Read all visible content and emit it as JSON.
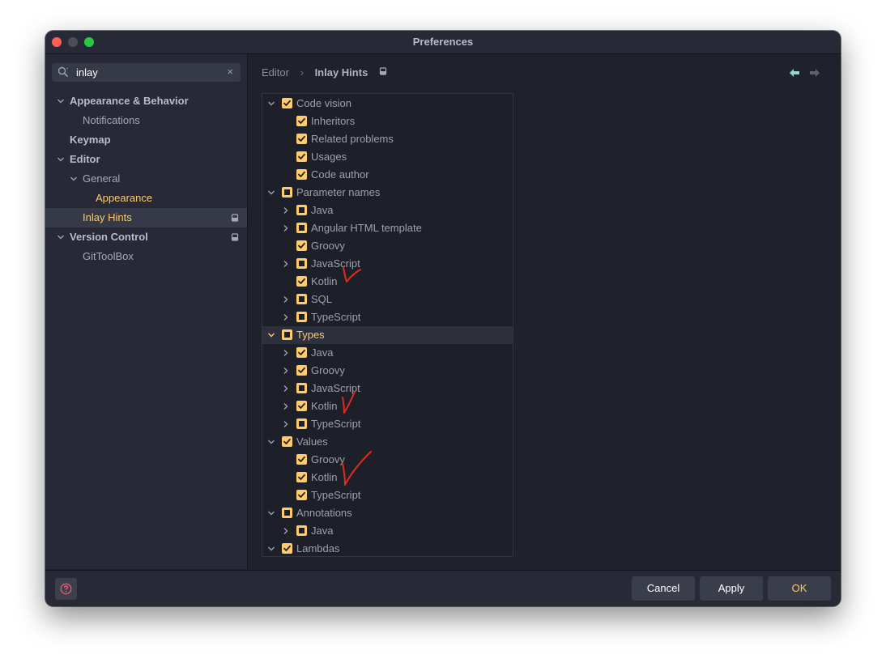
{
  "window": {
    "title": "Preferences"
  },
  "colors": {
    "accent": "#ffcb6b",
    "background": "#1f212c",
    "sidebar": "#272a36",
    "annotation": "#e02b1f",
    "close": "#fe5f57",
    "maximize": "#28c840"
  },
  "search": {
    "value": "inlay",
    "clear_icon": "×",
    "icon": "search-icon"
  },
  "sidebar": {
    "items": [
      {
        "label": "Appearance & Behavior",
        "expanded": true,
        "bold": true
      },
      {
        "label": "Notifications"
      },
      {
        "label": "Keymap",
        "bold": true
      },
      {
        "label": "Editor",
        "expanded": true,
        "bold": true
      },
      {
        "label": "General",
        "expanded": true
      },
      {
        "label": "Appearance",
        "highlight": true
      },
      {
        "label": "Inlay Hints",
        "selected": true,
        "highlight": true,
        "badge": "settings-scope-icon"
      },
      {
        "label": "Version Control",
        "expanded": true,
        "bold": true,
        "badge": "settings-scope-icon"
      },
      {
        "label": "GitToolBox"
      }
    ]
  },
  "breadcrumb": {
    "parent": "Editor",
    "separator": "›",
    "current": "Inlay Hints",
    "badge_icon": "settings-scope-icon"
  },
  "navigation": {
    "back_icon": "arrow-left-icon",
    "forward_icon": "arrow-right-icon"
  },
  "hints": {
    "rows": [
      {
        "label": "Code vision",
        "level": 0,
        "expander": "expanded",
        "state": "checked"
      },
      {
        "label": "Inheritors",
        "level": 1,
        "expander": "none",
        "state": "checked"
      },
      {
        "label": "Related problems",
        "level": 1,
        "expander": "none",
        "state": "checked"
      },
      {
        "label": "Usages",
        "level": 1,
        "expander": "none",
        "state": "checked"
      },
      {
        "label": "Code author",
        "level": 1,
        "expander": "none",
        "state": "checked"
      },
      {
        "label": "Parameter names",
        "level": 0,
        "expander": "expanded",
        "state": "partial"
      },
      {
        "label": "Java",
        "level": 1,
        "expander": "collapsed",
        "state": "partial"
      },
      {
        "label": "Angular HTML template",
        "level": 1,
        "expander": "collapsed",
        "state": "partial"
      },
      {
        "label": "Groovy",
        "level": 1,
        "expander": "none",
        "state": "checked"
      },
      {
        "label": "JavaScript",
        "level": 1,
        "expander": "collapsed",
        "state": "partial"
      },
      {
        "label": "Kotlin",
        "level": 1,
        "expander": "none",
        "state": "checked"
      },
      {
        "label": "SQL",
        "level": 1,
        "expander": "collapsed",
        "state": "partial"
      },
      {
        "label": "TypeScript",
        "level": 1,
        "expander": "collapsed",
        "state": "partial"
      },
      {
        "label": "Types",
        "level": 0,
        "expander": "expanded",
        "state": "partial",
        "selected": true
      },
      {
        "label": "Java",
        "level": 1,
        "expander": "collapsed",
        "state": "checked"
      },
      {
        "label": "Groovy",
        "level": 1,
        "expander": "collapsed",
        "state": "checked"
      },
      {
        "label": "JavaScript",
        "level": 1,
        "expander": "collapsed",
        "state": "partial"
      },
      {
        "label": "Kotlin",
        "level": 1,
        "expander": "collapsed",
        "state": "checked"
      },
      {
        "label": "TypeScript",
        "level": 1,
        "expander": "collapsed",
        "state": "partial"
      },
      {
        "label": "Values",
        "level": 0,
        "expander": "expanded",
        "state": "checked"
      },
      {
        "label": "Groovy",
        "level": 1,
        "expander": "none",
        "state": "checked"
      },
      {
        "label": "Kotlin",
        "level": 1,
        "expander": "none",
        "state": "checked"
      },
      {
        "label": "TypeScript",
        "level": 1,
        "expander": "none",
        "state": "checked"
      },
      {
        "label": "Annotations",
        "level": 0,
        "expander": "expanded",
        "state": "partial"
      },
      {
        "label": "Java",
        "level": 1,
        "expander": "collapsed",
        "state": "partial"
      },
      {
        "label": "Lambdas",
        "level": 0,
        "expander": "expanded",
        "state": "checked"
      }
    ]
  },
  "annotations": [
    {
      "mark": "checkmark",
      "next_to": "Parameter names › Kotlin"
    },
    {
      "mark": "checkmark",
      "next_to": "Types › Kotlin"
    },
    {
      "mark": "checkmark",
      "next_to": "Values › Kotlin"
    }
  ],
  "footer": {
    "help_icon": "help-icon",
    "cancel": "Cancel",
    "apply": "Apply",
    "ok": "OK"
  }
}
